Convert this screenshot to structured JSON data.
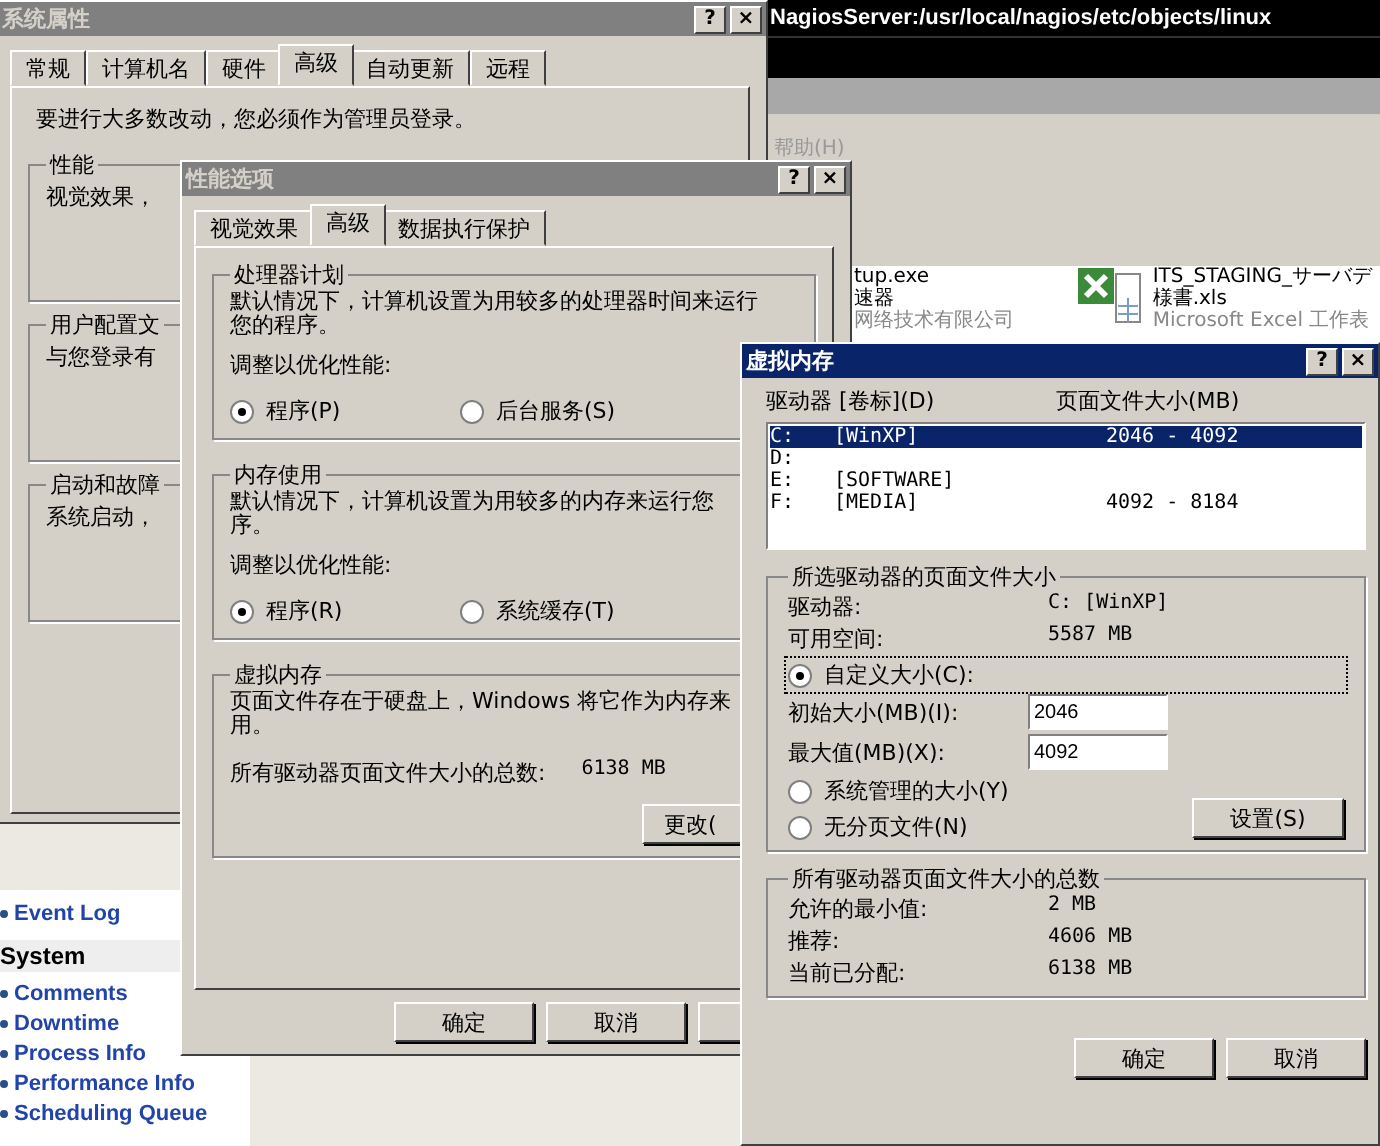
{
  "background_app": {
    "terminal_title": "NagiosServer:/usr/local/nagios/etc/objects/linux",
    "menu_item": "帮助(H)",
    "files": [
      {
        "kind": "exe",
        "name": "tup.exe",
        "line_2": "速器",
        "line_3": "网络技术有限公司"
      },
      {
        "kind": "excel",
        "name": "ITS_STAGING_サーバデ",
        "line_2": "様書.xls",
        "line_3": "Microsoft Excel 工作表"
      }
    ]
  },
  "nagios_sidebar": {
    "items": [
      {
        "kind": "link",
        "label": "Event Log"
      },
      {
        "kind": "header",
        "label": "System"
      },
      {
        "kind": "link",
        "label": "Comments"
      },
      {
        "kind": "link",
        "label": "Downtime"
      },
      {
        "kind": "link",
        "label": "Process Info"
      },
      {
        "kind": "link",
        "label": "Performance Info"
      },
      {
        "kind": "link",
        "label": "Scheduling Queue"
      }
    ]
  },
  "system_properties": {
    "title": "系统属性",
    "title_buttons": [
      "?",
      "×"
    ],
    "tabs": [
      {
        "label": "常规",
        "selected": false
      },
      {
        "label": "计算机名",
        "selected": false
      },
      {
        "label": "硬件",
        "selected": false
      },
      {
        "label": "高级",
        "selected": true
      },
      {
        "label": "自动更新",
        "selected": false
      },
      {
        "label": "远程",
        "selected": false
      }
    ],
    "notice": "要进行大多数改动，您必须作为管理员登录。",
    "groups": [
      {
        "title": "性能",
        "text": "视觉效果，"
      },
      {
        "title": "用户配置文",
        "text": "与您登录有"
      },
      {
        "title": "启动和故障",
        "text": "系统启动，"
      }
    ]
  },
  "performance_options": {
    "title": "性能选项",
    "title_buttons": [
      "?",
      "×"
    ],
    "tabs": [
      {
        "label": "视觉效果",
        "selected": false
      },
      {
        "label": "高级",
        "selected": true
      },
      {
        "label": "数据执行保护",
        "selected": false
      }
    ],
    "groups": [
      {
        "title": "处理器计划",
        "text": "默认情况下，计算机设置为用较多的处理器时间来运行",
        "text_2": "您的程序。",
        "prompt": "调整以优化性能:",
        "options": [
          {
            "label": "程序(P)",
            "selected": true
          },
          {
            "label": "后台服务(S)",
            "selected": false
          }
        ]
      },
      {
        "title": "内存使用",
        "text": "默认情况下，计算机设置为用较多的内存来运行您",
        "text_2": "序。",
        "prompt": "调整以优化性能:",
        "options": [
          {
            "label": "程序(R)",
            "selected": true
          },
          {
            "label": "系统缓存(T)",
            "selected": false
          }
        ]
      }
    ],
    "virtual_memory": {
      "title": "虚拟内存",
      "text": "页面文件存在于硬盘上，Windows 将它作为内存来",
      "text_2": "用。",
      "total_label": "所有驱动器页面文件大小的总数:",
      "total_value": "6138 MB",
      "button": "更改("
    },
    "buttons": [
      "确定",
      "取消"
    ]
  },
  "virtual_memory": {
    "title": "虚拟内存",
    "title_buttons": [
      "?",
      "×"
    ],
    "columns": [
      "驱动器 [卷标](D)",
      "页面文件大小(MB)"
    ],
    "drives": [
      {
        "drive": "C:",
        "label": "[WinXP]",
        "size": "2046 - 4092",
        "selected": true
      },
      {
        "drive": "D:",
        "selected": false
      },
      {
        "drive": "E:",
        "label": "[SOFTWARE]",
        "selected": false
      },
      {
        "drive": "F:",
        "label": "[MEDIA]",
        "size": "4092 - 8184",
        "selected": false
      }
    ],
    "selected_drive": {
      "title": "所选驱动器的页面文件大小",
      "drive_label": "驱动器:",
      "drive_value": "C:  [WinXP]",
      "free_label": "可用空间:",
      "free_value": "5587 MB",
      "options": [
        {
          "label": "自定义大小(C):",
          "selected": true
        },
        {
          "label": "系统管理的大小(Y)",
          "selected": false
        },
        {
          "label": "无分页文件(N)",
          "selected": false
        }
      ],
      "initial_label": "初始大小(MB)(I):",
      "initial_value": "2046",
      "max_label": "最大值(MB)(X):",
      "max_value": "4092",
      "set_button": "设置(S)"
    },
    "totals": {
      "title": "所有驱动器页面文件大小的总数",
      "rows": [
        {
          "label": "允许的最小值:",
          "value": "2 MB"
        },
        {
          "label": "推荐:",
          "value": "4606 MB"
        },
        {
          "label": "当前已分配:",
          "value": "6138 MB"
        }
      ]
    },
    "buttons": [
      "确定",
      "取消"
    ]
  }
}
